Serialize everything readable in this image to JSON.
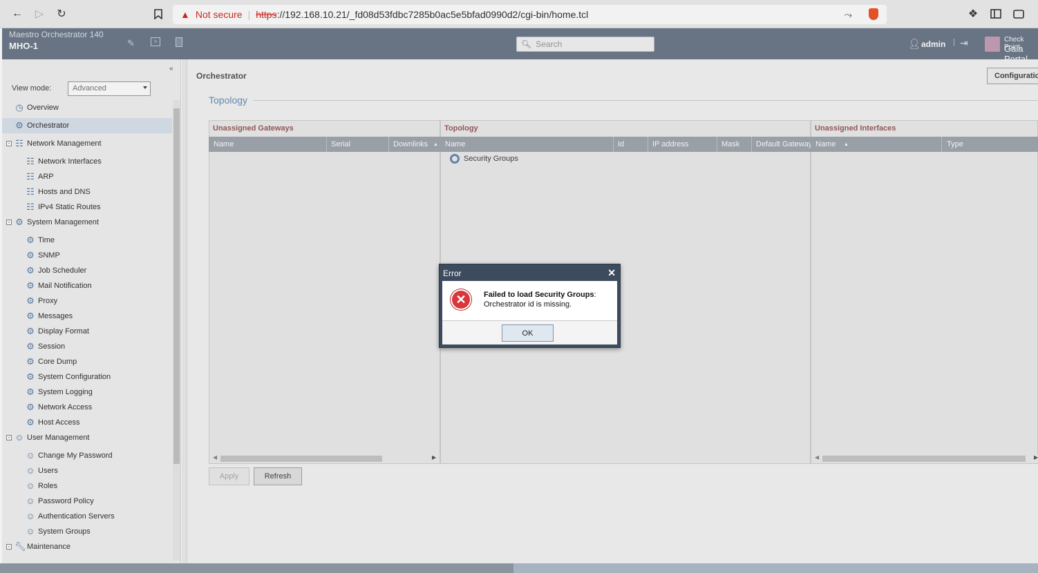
{
  "browser": {
    "security_label": "Not secure",
    "url_scheme": "https",
    "url_rest": "://192.168.10.21/_fd08d53fdbc7285b0ac5e5bfad0990d2/cgi-bin/home.tcl"
  },
  "header": {
    "product": "Maestro Orchestrator 140",
    "hostname": "MHO-1",
    "search_placeholder": "Search",
    "user": "admin",
    "brand_line1": "Check Point",
    "brand_line2": "Gaia Portal"
  },
  "sidebar": {
    "view_mode_label": "View mode:",
    "view_mode_value": "Advanced",
    "items": [
      {
        "label": "Overview"
      },
      {
        "label": "Orchestrator"
      },
      {
        "label": "Network Management"
      },
      {
        "label": "Network Interfaces"
      },
      {
        "label": "ARP"
      },
      {
        "label": "Hosts and DNS"
      },
      {
        "label": "IPv4 Static Routes"
      },
      {
        "label": "System Management"
      },
      {
        "label": "Time"
      },
      {
        "label": "SNMP"
      },
      {
        "label": "Job Scheduler"
      },
      {
        "label": "Mail Notification"
      },
      {
        "label": "Proxy"
      },
      {
        "label": "Messages"
      },
      {
        "label": "Display Format"
      },
      {
        "label": "Session"
      },
      {
        "label": "Core Dump"
      },
      {
        "label": "System Configuration"
      },
      {
        "label": "System Logging"
      },
      {
        "label": "Network Access"
      },
      {
        "label": "Host Access"
      },
      {
        "label": "User Management"
      },
      {
        "label": "Change My Password"
      },
      {
        "label": "Users"
      },
      {
        "label": "Roles"
      },
      {
        "label": "Password Policy"
      },
      {
        "label": "Authentication Servers"
      },
      {
        "label": "System Groups"
      },
      {
        "label": "Maintenance"
      }
    ]
  },
  "main": {
    "page_title": "Orchestrator",
    "config_button": "Configuration",
    "section_title": "Topology",
    "panels": {
      "unassigned_gateways": {
        "title": "Unassigned Gateways",
        "columns": [
          "Name",
          "Serial",
          "Downlinks"
        ]
      },
      "topology": {
        "title": "Topology",
        "columns": [
          "Name",
          "Id",
          "IP address",
          "Mask",
          "Default Gateway"
        ],
        "rows": [
          "Security Groups"
        ]
      },
      "unassigned_interfaces": {
        "title": "Unassigned Interfaces",
        "columns": [
          "Name",
          "Type"
        ]
      }
    },
    "apply_button": "Apply",
    "refresh_button": "Refresh"
  },
  "dialog": {
    "title": "Error",
    "message_bold": "Failed to load Security Groups",
    "message_suffix": ":",
    "message_line2": "Orchestrator id is missing.",
    "ok_button": "OK"
  }
}
